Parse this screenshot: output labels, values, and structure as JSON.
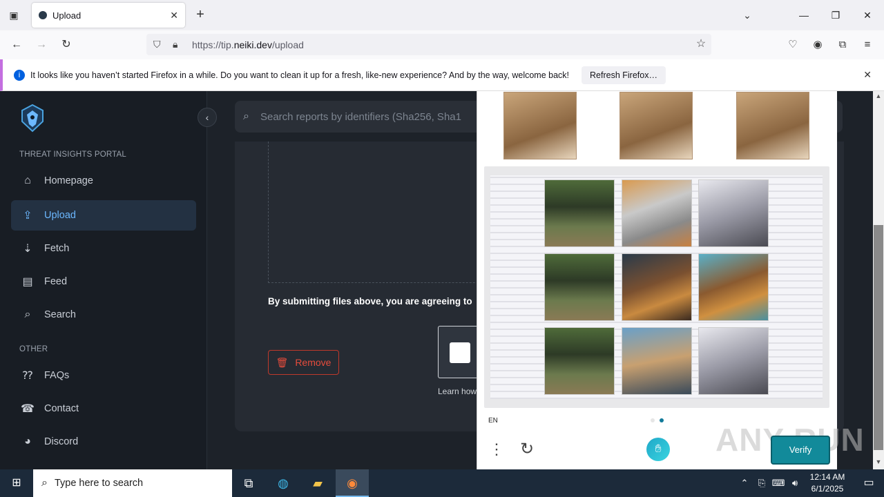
{
  "browser": {
    "tab_title": "Upload",
    "tab_close": "✕",
    "new_tab": "+",
    "url_prefix": "https://tip.",
    "url_domain": "neiki.dev",
    "url_path": "/upload"
  },
  "notification": {
    "message": "It looks like you haven’t started Firefox in a while. Do you want to clean it up for a fresh, like-new experience? And by the way, welcome back!",
    "button": "Refresh Firefox…"
  },
  "sidebar": {
    "section_main": "THREAT INSIGHTS PORTAL",
    "items_main": [
      {
        "label": "Homepage",
        "icon": "home-icon"
      },
      {
        "label": "Upload",
        "icon": "upload-icon"
      },
      {
        "label": "Fetch",
        "icon": "fetch-icon"
      },
      {
        "label": "Feed",
        "icon": "feed-icon"
      },
      {
        "label": "Search",
        "icon": "search-icon"
      }
    ],
    "section_other": "OTHER",
    "items_other": [
      {
        "label": "FAQs",
        "icon": "faq-icon"
      },
      {
        "label": "Contact",
        "icon": "contact-icon"
      },
      {
        "label": "Discord",
        "icon": "discord-icon"
      }
    ]
  },
  "main": {
    "search_placeholder": "Search reports by identifiers (Sha256, Sha1",
    "agree_text": "By submitting files above, you are agreeing to",
    "remove_button": "Remove",
    "learn_text": "Learn how"
  },
  "captcha": {
    "language": "EN",
    "verify_button": "Verify",
    "page_indicator": {
      "total": 2,
      "current": 2
    },
    "tiles": [
      {
        "subject": "forest"
      },
      {
        "subject": "toaster"
      },
      {
        "subject": "toaster"
      },
      {
        "subject": "forest"
      },
      {
        "subject": "bear-guitar"
      },
      {
        "subject": "bear-guitar"
      },
      {
        "subject": "forest"
      },
      {
        "subject": "construction-site"
      },
      {
        "subject": "toaster"
      }
    ]
  },
  "watermark": "ANY RUN",
  "taskbar": {
    "search_placeholder": "Type here to search",
    "time": "12:14 AM",
    "date": "6/1/2025"
  },
  "colors": {
    "accent": "#6cb8ff",
    "active_bg": "#233142",
    "remove_red": "#e74c3c",
    "verify_teal": "#128a9a"
  }
}
